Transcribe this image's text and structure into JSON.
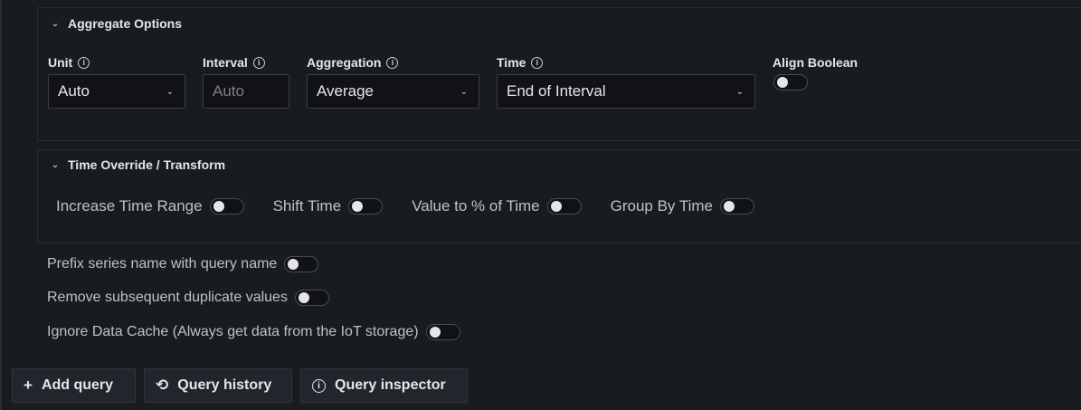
{
  "aggregate": {
    "header": "Aggregate Options",
    "unit": {
      "label": "Unit",
      "value": "Auto"
    },
    "interval": {
      "label": "Interval",
      "placeholder": "Auto"
    },
    "aggregation": {
      "label": "Aggregation",
      "value": "Average"
    },
    "time": {
      "label": "Time",
      "value": "End of Interval"
    },
    "align_boolean": {
      "label": "Align Boolean",
      "checked": false
    }
  },
  "time_override": {
    "header": "Time Override / Transform",
    "toggles": [
      {
        "label": "Increase Time Range",
        "checked": false
      },
      {
        "label": "Shift Time",
        "checked": false
      },
      {
        "label": "Value to % of Time",
        "checked": false
      },
      {
        "label": "Group By Time",
        "checked": false
      }
    ]
  },
  "options": [
    {
      "label": "Prefix series name with query name",
      "checked": false
    },
    {
      "label": "Remove subsequent duplicate values",
      "checked": false
    },
    {
      "label": "Ignore Data Cache (Always get data from the IoT storage)",
      "checked": false
    }
  ],
  "buttons": {
    "add_query": "Add query",
    "query_history": "Query history",
    "query_inspector": "Query inspector"
  },
  "icons": {
    "chevron": "chevron-down-icon",
    "info": "info-circle-icon",
    "plus": "plus-icon",
    "history": "history-icon"
  }
}
